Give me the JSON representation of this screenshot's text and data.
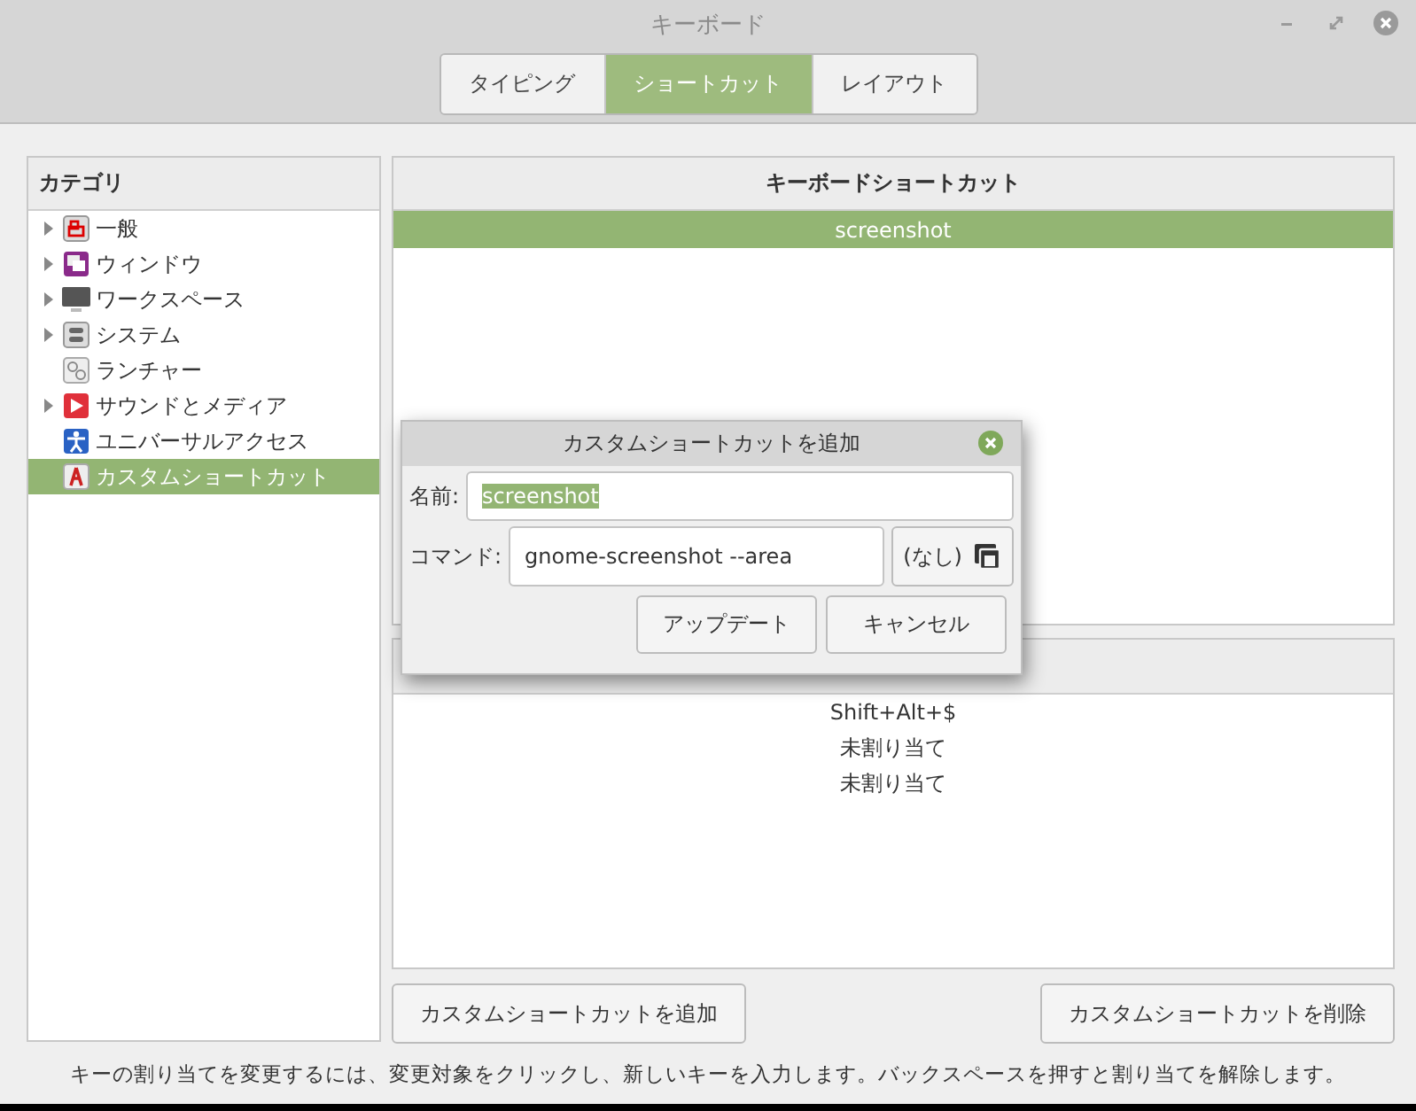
{
  "window": {
    "title": "キーボード"
  },
  "tabs": [
    {
      "label": "タイピング",
      "selected": false
    },
    {
      "label": "ショートカット",
      "selected": true
    },
    {
      "label": "レイアウト",
      "selected": false
    }
  ],
  "categories": {
    "header": "カテゴリ",
    "items": [
      {
        "label": "一般",
        "expandable": true,
        "selected": false
      },
      {
        "label": "ウィンドウ",
        "expandable": true,
        "selected": false
      },
      {
        "label": "ワークスペース",
        "expandable": true,
        "selected": false
      },
      {
        "label": "システム",
        "expandable": true,
        "selected": false
      },
      {
        "label": "ランチャー",
        "expandable": false,
        "selected": false
      },
      {
        "label": "サウンドとメディア",
        "expandable": true,
        "selected": false
      },
      {
        "label": "ユニバーサルアクセス",
        "expandable": false,
        "selected": false
      },
      {
        "label": "カスタムショートカット",
        "expandable": false,
        "selected": true
      }
    ]
  },
  "shortcuts": {
    "header": "キーボードショートカット",
    "rows": [
      {
        "label": "screenshot",
        "selected": true
      }
    ]
  },
  "bindings": {
    "rows": [
      "Shift+Alt+$",
      "未割り当て",
      "未割り当て"
    ]
  },
  "buttons": {
    "add": "カスタムショートカットを追加",
    "remove": "カスタムショートカットを削除"
  },
  "status": "キーの割り当てを変更するには、変更対象をクリックし、新しいキーを入力します。バックスペースを押すと割り当てを解除します。",
  "dialog": {
    "title": "カスタムショートカットを追加",
    "name_label": "名前:",
    "name_value": "screenshot",
    "name_selected": true,
    "command_label": "コマンド:",
    "command_value": "gnome-screenshot --area",
    "file_button": "(なし)",
    "update": "アップデート",
    "cancel": "キャンセル"
  }
}
